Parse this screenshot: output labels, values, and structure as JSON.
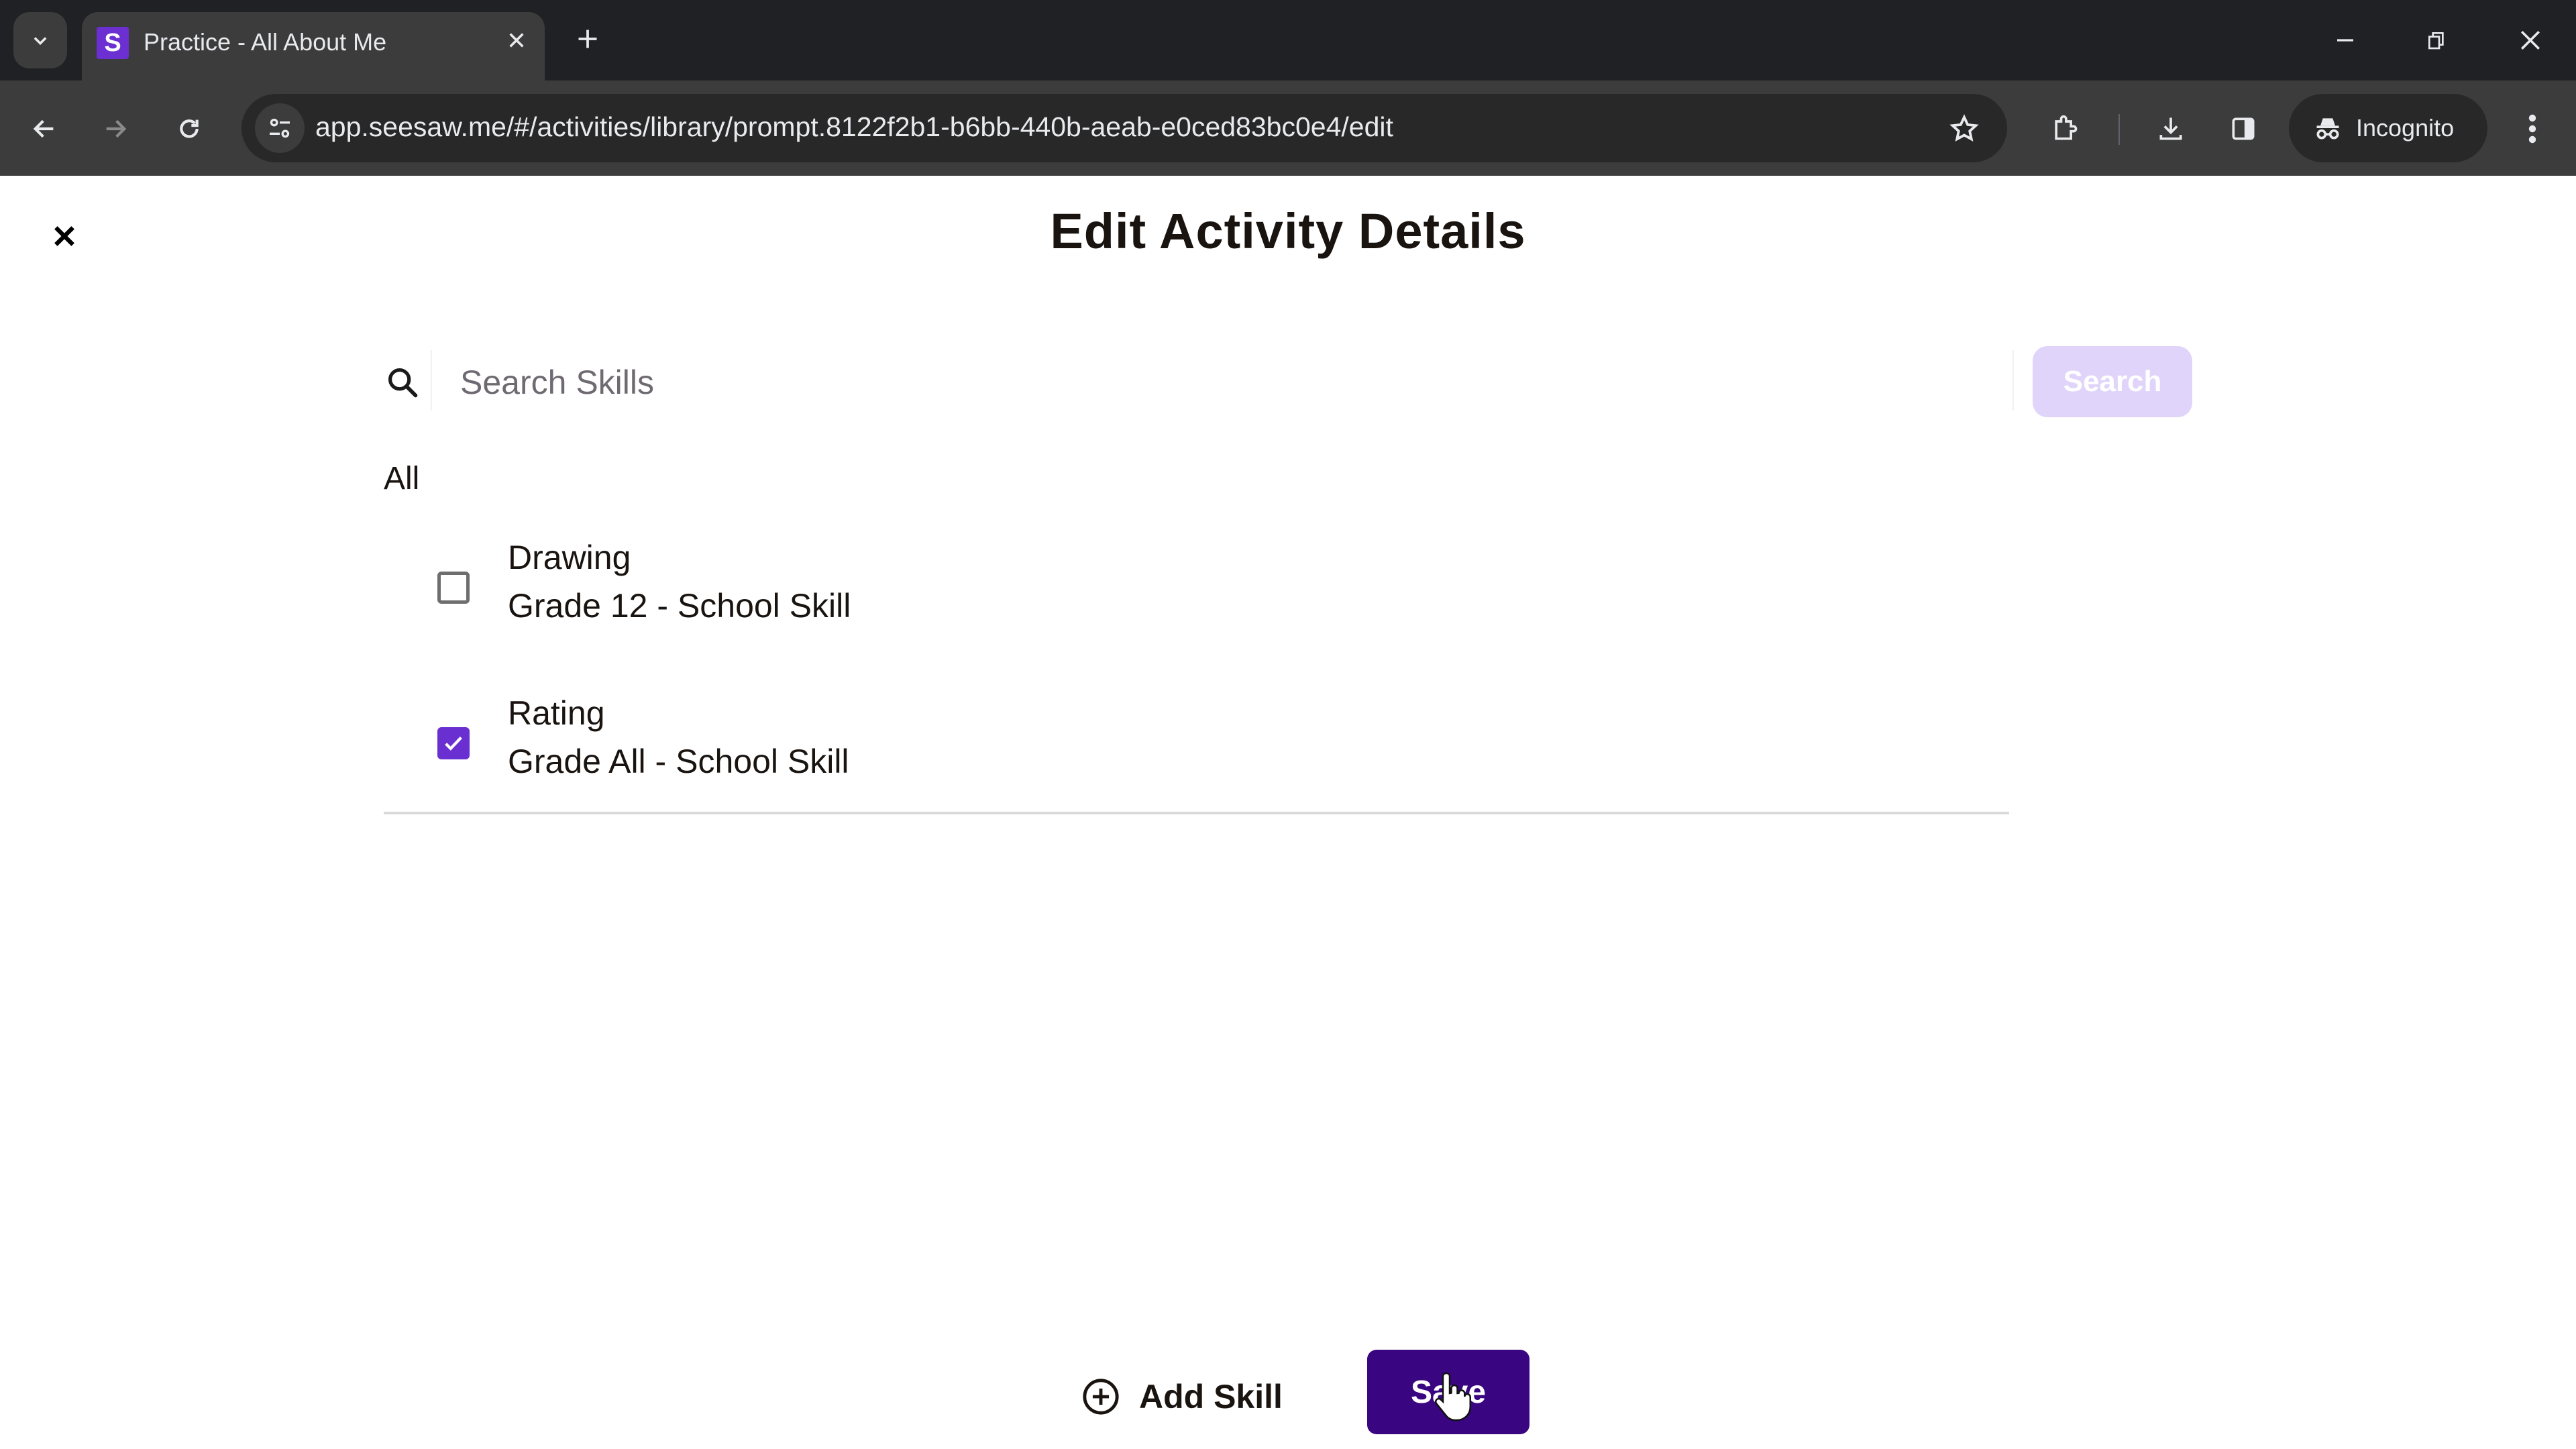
{
  "browser": {
    "tab": {
      "title": "Practice - All About Me",
      "favicon_letter": "S",
      "favicon_color": "#6b2fd2"
    },
    "url": "app.seesaw.me/#/activities/library/prompt.8122f2b1-b6bb-440b-aeab-e0ced83bc0e4/edit",
    "incognito_label": "Incognito",
    "icons": [
      "tab-search-icon",
      "close-icon",
      "new-tab-icon",
      "minimize-icon",
      "restore-icon",
      "window-close-icon",
      "back-icon",
      "forward-icon",
      "reload-icon",
      "site-info-icon",
      "bookmark-star-icon",
      "extensions-icon",
      "download-icon",
      "side-panel-icon",
      "incognito-icon",
      "kebab-menu-icon"
    ]
  },
  "page": {
    "title": "Edit Activity Details",
    "search": {
      "placeholder": "Search Skills",
      "value": "",
      "button_label": "Search"
    },
    "filter_label": "All",
    "skills": [
      {
        "name": "Drawing",
        "detail": "Grade 12 - School Skill",
        "checked": false
      },
      {
        "name": "Rating",
        "detail": "Grade All - School Skill",
        "checked": true
      }
    ],
    "add_skill_label": "Add Skill",
    "save_label": "Save"
  },
  "colors": {
    "accent": "#6a2fd0",
    "save_button": "#390580",
    "search_button_disabled": "#e0d4fb",
    "text": "#1a1410"
  }
}
